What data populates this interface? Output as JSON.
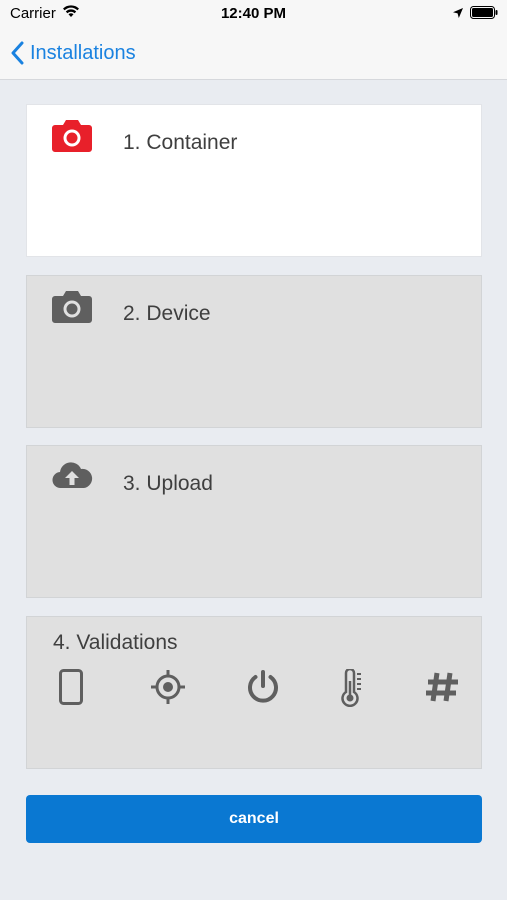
{
  "status_bar": {
    "carrier": "Carrier",
    "time": "12:40 PM"
  },
  "nav": {
    "back_label": "Installations"
  },
  "steps": [
    {
      "label": "1. Container",
      "icon": "camera-icon",
      "state": "active",
      "icon_color": "#e8202a"
    },
    {
      "label": "2. Device",
      "icon": "camera-icon",
      "state": "inactive",
      "icon_color": "#5f5f5f"
    },
    {
      "label": "3. Upload",
      "icon": "cloud-upload-icon",
      "state": "inactive",
      "icon_color": "#5f5f5f"
    },
    {
      "label": "4. Validations",
      "state": "inactive"
    }
  ],
  "validation_icons": [
    "mobile-phone-icon",
    "crosshair-icon",
    "power-icon",
    "thermometer-icon",
    "hashtag-icon"
  ],
  "cancel_label": "cancel",
  "colors": {
    "accent": "#1a82e0",
    "button": "#0a78d2",
    "active_icon": "#e8202a",
    "inactive_icon": "#5f5f5f",
    "card_inactive": "#e0e0e0",
    "background": "#e9ecf1"
  }
}
